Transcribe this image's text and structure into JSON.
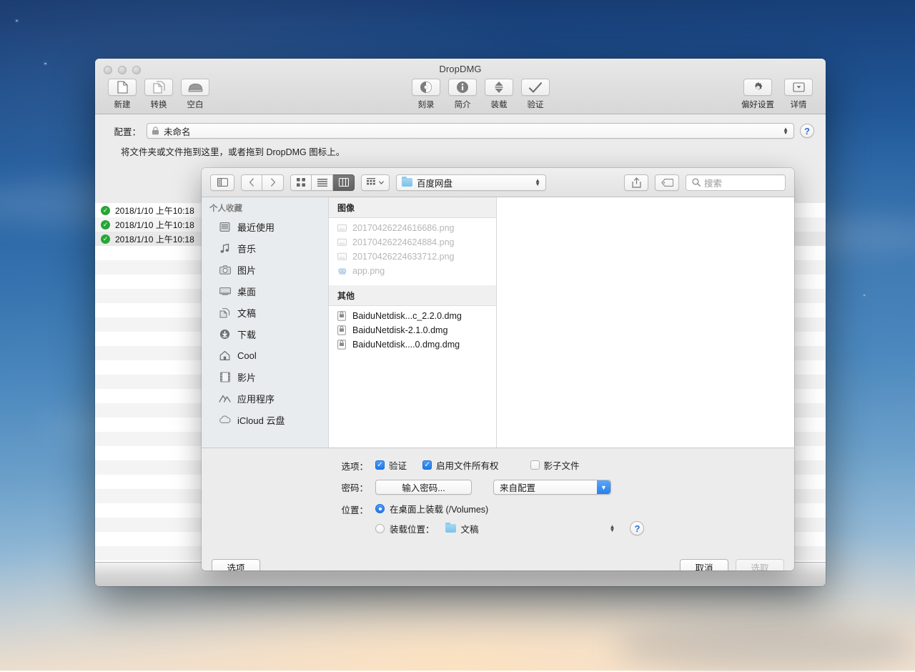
{
  "app": {
    "window_title": "DropDMG",
    "toolbar_left": [
      {
        "label": "新建",
        "icon": "new-document-icon"
      },
      {
        "label": "转换",
        "icon": "convert-documents-icon"
      },
      {
        "label": "空白",
        "icon": "blank-disk-icon"
      }
    ],
    "toolbar_center": [
      {
        "label": "刻录",
        "icon": "burn-icon"
      },
      {
        "label": "简介",
        "icon": "info-icon"
      },
      {
        "label": "装载",
        "icon": "mount-icon"
      },
      {
        "label": "验证",
        "icon": "verify-checkmark-icon"
      }
    ],
    "toolbar_right": [
      {
        "label": "偏好设置",
        "icon": "gear-icon"
      },
      {
        "label": "详情",
        "icon": "details-panel-icon"
      }
    ],
    "config": {
      "label": "配置：",
      "value": "未命名",
      "help_label": "?"
    },
    "drop_hint": "将文件夹或文件拖到这里，或者拖到 DropDMG 图标上。",
    "log_rows": [
      {
        "status": "success",
        "time": "2018/1/10 上午10:18"
      },
      {
        "status": "success",
        "time": "2018/1/10 上午10:18"
      },
      {
        "status": "success",
        "time": "2018/1/10 上午10:18"
      }
    ]
  },
  "sheet": {
    "toolbar": {
      "sidebar_toggle": "sidebar-toggle-icon",
      "back": "chevron-left-icon",
      "forward": "chevron-right-icon",
      "view_icon": "icon-view-icon",
      "view_list": "list-view-icon",
      "view_column": "column-view-icon",
      "arrange": "arrange-by-icon",
      "path_value": "百度网盘",
      "share": "share-icon",
      "tag": "tag-icon",
      "search_placeholder": "搜索"
    },
    "sidebar": {
      "heading": "个人收藏",
      "items": [
        {
          "label": "最近使用",
          "icon": "recents-icon"
        },
        {
          "label": "音乐",
          "icon": "music-note-icon"
        },
        {
          "label": "图片",
          "icon": "camera-icon"
        },
        {
          "label": "桌面",
          "icon": "desktop-icon"
        },
        {
          "label": "文稿",
          "icon": "documents-icon"
        },
        {
          "label": "下载",
          "icon": "download-arrow-icon"
        },
        {
          "label": "Cool",
          "icon": "home-icon"
        },
        {
          "label": "影片",
          "icon": "film-icon"
        },
        {
          "label": "应用程序",
          "icon": "applications-icon"
        },
        {
          "label": "iCloud 云盘",
          "icon": "cloud-icon"
        }
      ]
    },
    "columns": [
      {
        "header": "图像",
        "files": [
          {
            "name": "20170426224616686.png",
            "icon": "image-file-icon",
            "disabled": true
          },
          {
            "name": "20170426224624884.png",
            "icon": "image-file-icon",
            "disabled": true
          },
          {
            "name": "20170426224633712.png",
            "icon": "image-file-icon",
            "disabled": true
          },
          {
            "name": "app.png",
            "icon": "png-preview-icon",
            "disabled": true
          }
        ]
      },
      {
        "header": "其他",
        "files": [
          {
            "name": "BaiduNetdisk...c_2.2.0.dmg",
            "icon": "disk-image-icon",
            "disabled": false
          },
          {
            "name": "BaiduNetdisk-2.1.0.dmg",
            "icon": "disk-image-icon",
            "disabled": false
          },
          {
            "name": "BaiduNetdisk....0.dmg.dmg",
            "icon": "disk-image-icon",
            "disabled": false
          }
        ]
      }
    ],
    "options": {
      "options_label": "选项：",
      "verify": {
        "label": "验证",
        "checked": true
      },
      "ownership": {
        "label": "启用文件所有权",
        "checked": true
      },
      "shadow": {
        "label": "影子文件",
        "checked": false
      },
      "password_label": "密码：",
      "password_button": "输入密码...",
      "password_source": "来自配置",
      "location_label": "位置：",
      "mount_desktop": {
        "label": "在桌面上装载 (/Volumes)",
        "selected": true
      },
      "mount_at": {
        "label": "装载位置：",
        "value": "文稿",
        "selected": false
      },
      "help_label": "?"
    },
    "footer": {
      "options_button": "选项",
      "cancel_button": "取消",
      "choose_button": "选取"
    }
  },
  "colors": {
    "accent_blue": "#1f79ec",
    "success_green": "#26a637",
    "help_blue": "#2f6fd0",
    "folder_blue": "#7cc3ea"
  }
}
